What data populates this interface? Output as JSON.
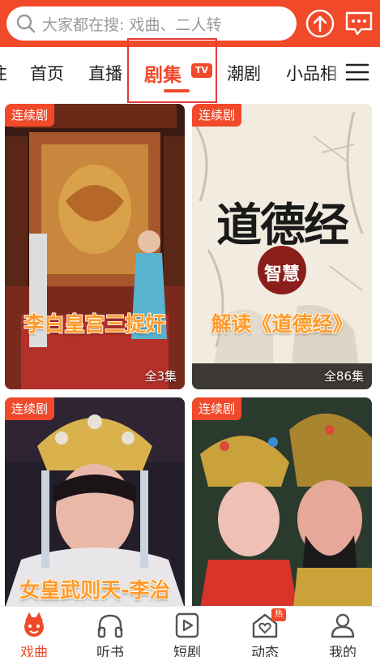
{
  "search": {
    "placeholder": "大家都在搜: 戏曲、二人转"
  },
  "tabs": [
    {
      "label": "注"
    },
    {
      "label": "首页"
    },
    {
      "label": "直播"
    },
    {
      "label": "剧集",
      "badge": "TV",
      "active": true
    },
    {
      "label": "潮剧"
    },
    {
      "label": "小品相"
    }
  ],
  "cards": [
    {
      "tag": "连续剧",
      "title": "李白皇宫三捉奸",
      "count": "全3集"
    },
    {
      "tag": "连续剧",
      "title": "解读《道德经》",
      "count": "全86集",
      "art_title": "道德经",
      "art_subtitle": "智慧"
    },
    {
      "tag": "连续剧",
      "title": "女皇武则天-李治",
      "count": ""
    },
    {
      "tag": "连续剧",
      "title": "",
      "count": ""
    }
  ],
  "nav": [
    {
      "label": "戏曲",
      "icon": "opera-mascot-icon",
      "active": true
    },
    {
      "label": "听书",
      "icon": "headphones-icon"
    },
    {
      "label": "短剧",
      "icon": "play-icon"
    },
    {
      "label": "动态",
      "icon": "heart-home-icon",
      "badge": "热"
    },
    {
      "label": "我的",
      "icon": "user-icon"
    }
  ],
  "colors": {
    "accent": "#f04a2b",
    "title_orange": "#ff9a2e"
  }
}
